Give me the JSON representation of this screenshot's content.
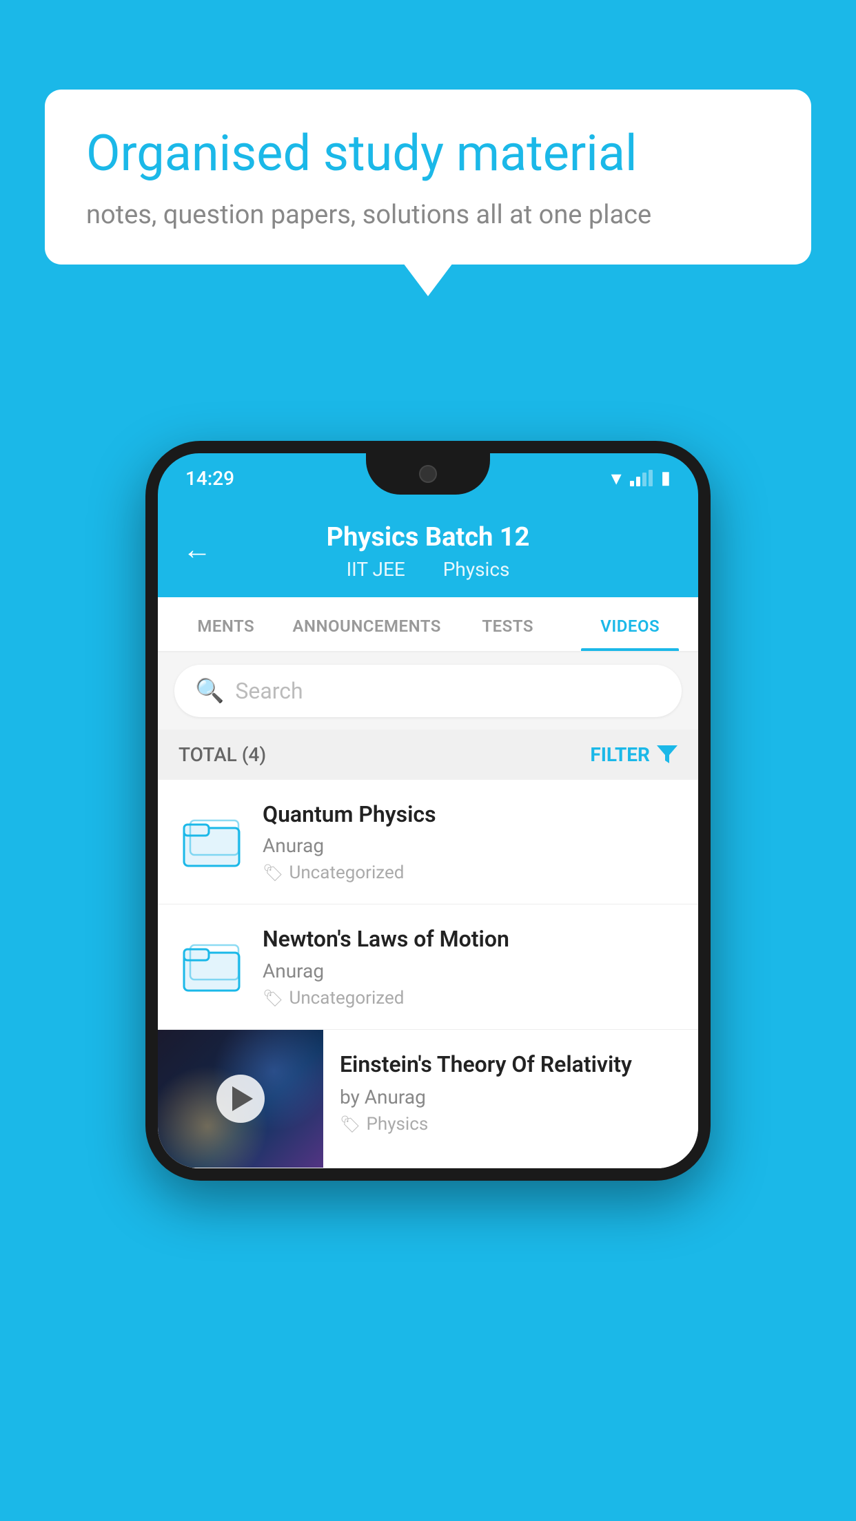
{
  "background": {
    "color": "#1bb8e8"
  },
  "speech_bubble": {
    "title": "Organised study material",
    "subtitle": "notes, question papers, solutions all at one place"
  },
  "phone": {
    "status_bar": {
      "time": "14:29"
    },
    "header": {
      "back_label": "←",
      "title": "Physics Batch 12",
      "subtitle_left": "IIT JEE",
      "subtitle_right": "Physics"
    },
    "tabs": [
      {
        "label": "MENTS",
        "active": false
      },
      {
        "label": "ANNOUNCEMENTS",
        "active": false
      },
      {
        "label": "TESTS",
        "active": false
      },
      {
        "label": "VIDEOS",
        "active": true
      }
    ],
    "search": {
      "placeholder": "Search"
    },
    "filter_bar": {
      "total_label": "TOTAL (4)",
      "filter_label": "FILTER"
    },
    "videos": [
      {
        "id": "quantum",
        "title": "Quantum Physics",
        "author": "Anurag",
        "tag": "Uncategorized",
        "has_thumb": false
      },
      {
        "id": "newton",
        "title": "Newton's Laws of Motion",
        "author": "Anurag",
        "tag": "Uncategorized",
        "has_thumb": false
      },
      {
        "id": "einstein",
        "title": "Einstein's Theory Of Relativity",
        "author": "by Anurag",
        "tag": "Physics",
        "has_thumb": true
      }
    ]
  }
}
